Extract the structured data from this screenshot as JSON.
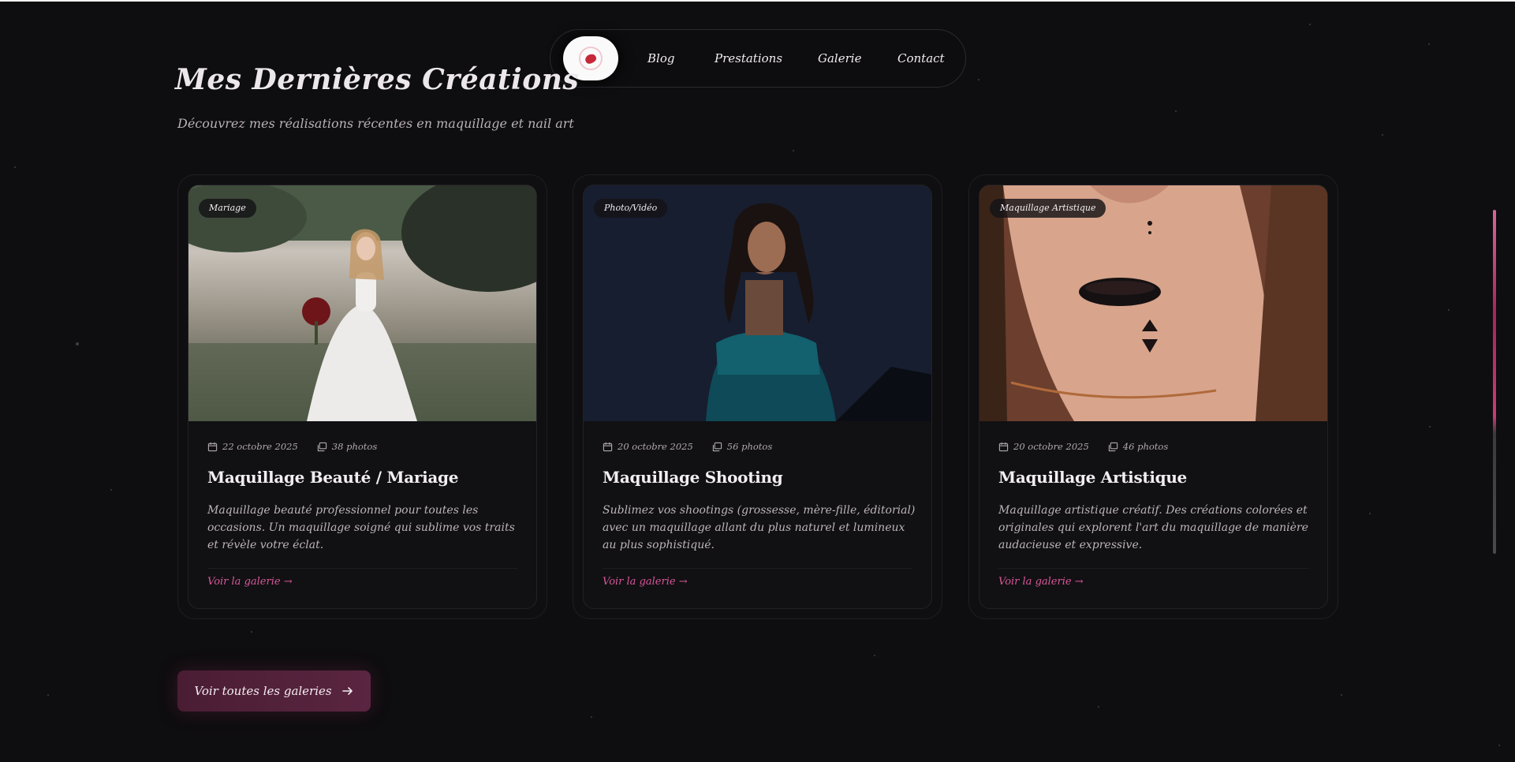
{
  "nav": {
    "items": [
      "Blog",
      "Prestations",
      "Galerie",
      "Contact"
    ]
  },
  "header": {
    "title": "Mes Dernières Créations",
    "subtitle": "Découvrez mes réalisations récentes en maquillage et nail art"
  },
  "cards": [
    {
      "badge": "Mariage",
      "date": "22 octobre 2025",
      "photos": "38 photos",
      "title": "Maquillage Beauté / Mariage",
      "description": "Maquillage beauté professionnel pour toutes les occasions. Un maquillage soigné qui sublime vos traits et révèle votre éclat.",
      "link": "Voir la galerie →"
    },
    {
      "badge": "Photo/Vidéo",
      "date": "20 octobre 2025",
      "photos": "56 photos",
      "title": "Maquillage Shooting",
      "description": "Sublimez vos shootings (grossesse, mère-fille, éditorial) avec un maquillage allant du plus naturel et lumineux au plus sophistiqué.",
      "link": "Voir la galerie →"
    },
    {
      "badge": "Maquillage Artistique",
      "date": "20 octobre 2025",
      "photos": "46 photos",
      "title": "Maquillage Artistique",
      "description": "Maquillage artistique créatif. Des créations colorées et originales qui explorent l'art du maquillage de manière audacieuse et expressive.",
      "link": "Voir la galerie →"
    }
  ],
  "cta": {
    "label": "Voir toutes les galeries"
  },
  "colors": {
    "accent": "#d9589a",
    "background": "#0e0d0f",
    "cta": "#4a1d34"
  }
}
